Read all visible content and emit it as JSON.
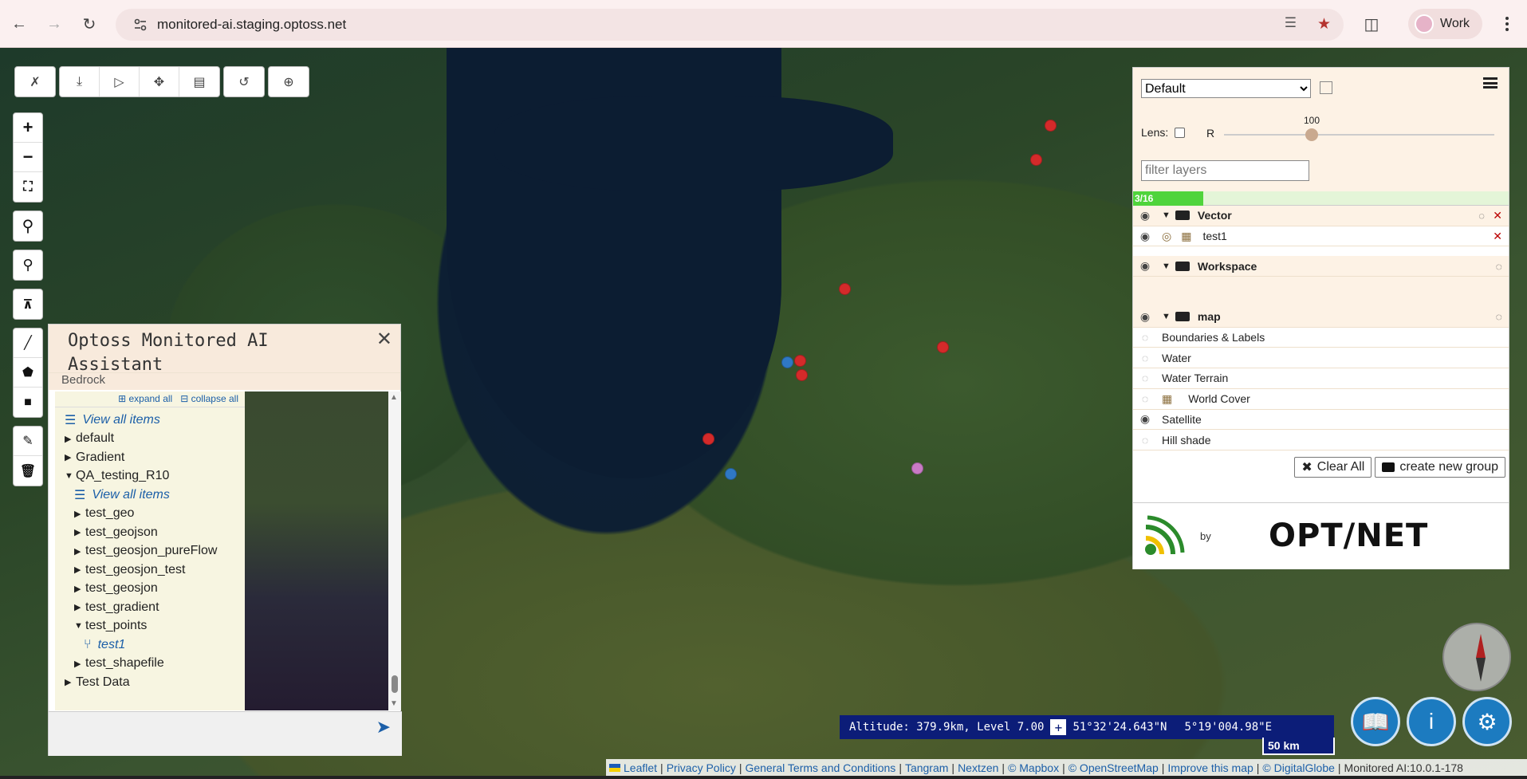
{
  "browser": {
    "url": "monitored-ai.staging.optoss.net",
    "profile_label": "Work"
  },
  "top_toolbar": {
    "icons": [
      "no-cursor-icon",
      "download-icon",
      "video-icon",
      "move-icon",
      "layers-print-icon",
      "reset-icon",
      "add-circle-icon"
    ]
  },
  "left_tools": {
    "icons": [
      "zoom-in-icon",
      "zoom-out-icon",
      "fullscreen-icon",
      "location-pin-icon",
      "zoom-box-icon",
      "collapse-up-icon",
      "draw-line-icon",
      "draw-polygon-icon",
      "draw-rectangle-icon",
      "edit-icon",
      "trash-icon"
    ]
  },
  "assistant": {
    "title": "Optoss Monitored AI Assistant",
    "subtitle": "Bedrock",
    "expand_all": "expand all",
    "collapse_all": "collapse all",
    "tree": [
      {
        "label": "View all items",
        "type": "link",
        "indent": 0
      },
      {
        "label": "default",
        "type": "folder",
        "indent": 0,
        "open": false
      },
      {
        "label": "Gradient",
        "type": "folder",
        "indent": 0,
        "open": false
      },
      {
        "label": "QA_testing_R10",
        "type": "folder",
        "indent": 0,
        "open": true
      },
      {
        "label": "View all items",
        "type": "link",
        "indent": 1
      },
      {
        "label": "test_geo",
        "type": "folder",
        "indent": 1,
        "open": false
      },
      {
        "label": "test_geojson",
        "type": "folder",
        "indent": 1,
        "open": false
      },
      {
        "label": "test_geosjon_pureFlow",
        "type": "folder",
        "indent": 1,
        "open": false
      },
      {
        "label": "test_geosjon_test",
        "type": "folder",
        "indent": 1,
        "open": false
      },
      {
        "label": "test_geosjon",
        "type": "folder",
        "indent": 1,
        "open": false
      },
      {
        "label": "test_gradient",
        "type": "folder",
        "indent": 1,
        "open": false
      },
      {
        "label": "test_points",
        "type": "folder",
        "indent": 1,
        "open": true
      },
      {
        "label": "test1",
        "type": "item",
        "indent": 2
      },
      {
        "label": "test_shapefile",
        "type": "folder",
        "indent": 1,
        "open": false
      },
      {
        "label": "Test Data",
        "type": "folder",
        "indent": 0,
        "open": false
      }
    ]
  },
  "layers": {
    "preset": "Default",
    "lens_label": "Lens:",
    "r_label": "R",
    "slider_value": "100",
    "slider_fraction": 0.3,
    "filter_placeholder": "filter layers",
    "progress_text": "3/16",
    "progress_fraction": 0.1875,
    "groups": {
      "vector": "Vector",
      "workspace": "Workspace",
      "map": "map"
    },
    "vector_items": [
      "test1"
    ],
    "map_items": [
      {
        "label": "Boundaries & Labels",
        "visible": false
      },
      {
        "label": "Water",
        "visible": false
      },
      {
        "label": "Water Terrain",
        "visible": false
      },
      {
        "label": "World Cover",
        "visible": false
      },
      {
        "label": "Satellite",
        "visible": true
      },
      {
        "label": "Hill shade",
        "visible": false
      }
    ],
    "clear_all": "Clear All",
    "create_group": "create new group",
    "brand_by": "by",
    "brand_name": "OPT/NET"
  },
  "coords": {
    "altitude": "Altitude: 379.9km, Level 7.00",
    "lat": "51°32'24.643\"N",
    "lon": "5°19'004.98\"E",
    "scale": "50 km"
  },
  "attribution": [
    "Leaflet",
    "Privacy Policy",
    "General Terms and Conditions",
    "Tangram",
    "Nextzen",
    "© Mapbox",
    "© OpenStreetMap",
    "Improve this map",
    "© DigitalGlobe"
  ],
  "version": "Monitored AI:10.0.1-178",
  "markers": [
    {
      "color": "#d42a2a"
    },
    {
      "color": "#d42a2a"
    },
    {
      "color": "#d42a2a"
    },
    {
      "color": "#d42a2a"
    },
    {
      "color": "#d42a2a"
    },
    {
      "color": "#d42a2a"
    },
    {
      "color": "#d42a2a"
    },
    {
      "color": "#2f78c4"
    },
    {
      "color": "#2f78c4"
    },
    {
      "color": "#c97ac6"
    }
  ]
}
